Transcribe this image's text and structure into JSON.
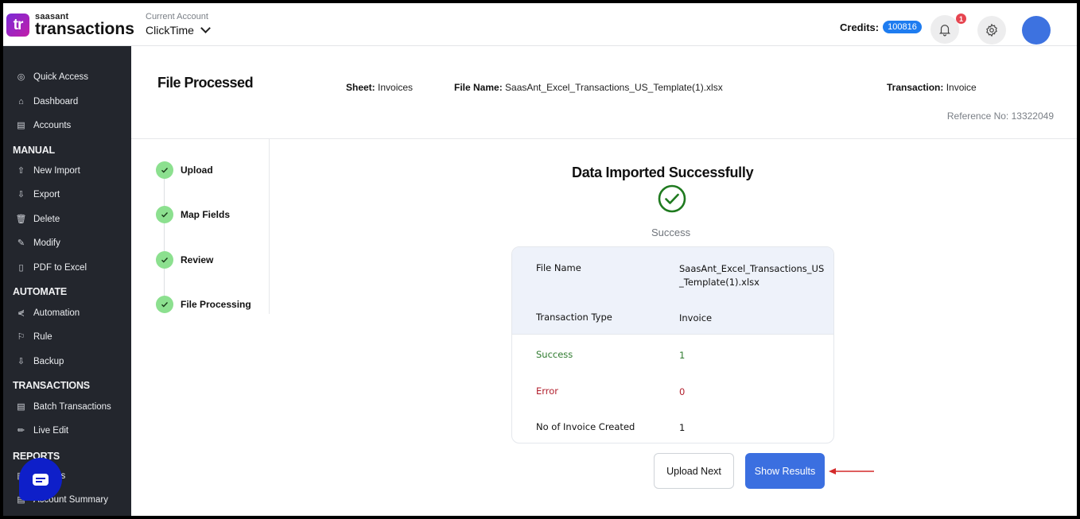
{
  "header": {
    "logo_small": "saasant",
    "logo_big": "transactions",
    "logo_badge": "tr",
    "account_label": "Current Account",
    "account_value": "ClickTime",
    "credits_label": "Credits:",
    "credits_value": "100816",
    "notification_count": "1"
  },
  "sidebar": {
    "top_items": [
      {
        "label": "Quick Access",
        "icon": "quick-access-icon"
      },
      {
        "label": "Dashboard",
        "icon": "home-icon"
      },
      {
        "label": "Accounts",
        "icon": "clipboard-icon"
      }
    ],
    "sections": [
      {
        "title": "MANUAL",
        "items": [
          {
            "label": "New Import",
            "icon": "cloud-upload-icon"
          },
          {
            "label": "Export",
            "icon": "cloud-download-icon"
          },
          {
            "label": "Delete",
            "icon": "trash-icon"
          },
          {
            "label": "Modify",
            "icon": "edit-file-icon"
          },
          {
            "label": "PDF to Excel",
            "icon": "pdf-icon"
          }
        ]
      },
      {
        "title": "AUTOMATE",
        "items": [
          {
            "label": "Automation",
            "icon": "share-nodes-icon"
          },
          {
            "label": "Rule",
            "icon": "rule-icon"
          },
          {
            "label": "Backup",
            "icon": "cloud-download-icon"
          }
        ]
      },
      {
        "title": "TRANSACTIONS",
        "items": [
          {
            "label": "Batch Transactions",
            "icon": "document-icon"
          },
          {
            "label": "Live Edit",
            "icon": "pencil-icon"
          }
        ]
      },
      {
        "title": "REPORTS",
        "items": [
          {
            "label": "Reports",
            "icon": "report-icon"
          },
          {
            "label": "Account Summary",
            "icon": "clipboard-icon"
          }
        ]
      }
    ]
  },
  "page": {
    "title": "File Processed",
    "sheet_label": "Sheet:",
    "sheet_value": "Invoices",
    "file_label": "File Name:",
    "file_value": "SaasAnt_Excel_Transactions_US_Template(1).xlsx",
    "transaction_label": "Transaction:",
    "transaction_value": "Invoice",
    "reference": "Reference No: 13322049"
  },
  "steps": [
    {
      "label": "Upload",
      "status": "complete"
    },
    {
      "label": "Map Fields",
      "status": "complete"
    },
    {
      "label": "Review",
      "status": "complete"
    },
    {
      "label": "File Processing",
      "status": "complete"
    }
  ],
  "result": {
    "title": "Data Imported Successfully",
    "status": "Success",
    "rows": [
      {
        "key": "File Name",
        "value": "SaasAnt_Excel_Transactions_US_Template(1).xlsx"
      },
      {
        "key": "Transaction Type",
        "value": "Invoice"
      },
      {
        "key": "Success",
        "value": "1"
      },
      {
        "key": "Error",
        "value": "0"
      },
      {
        "key": "No of Invoice Created",
        "value": "1"
      }
    ],
    "upload_next_label": "Upload Next",
    "show_results_label": "Show Results"
  },
  "colors": {
    "primary": "#3b6fe0",
    "success": "#2f7b2f",
    "error": "#b2202e",
    "step_complete": "#8ce08f",
    "sidebar_bg": "#23262d"
  }
}
